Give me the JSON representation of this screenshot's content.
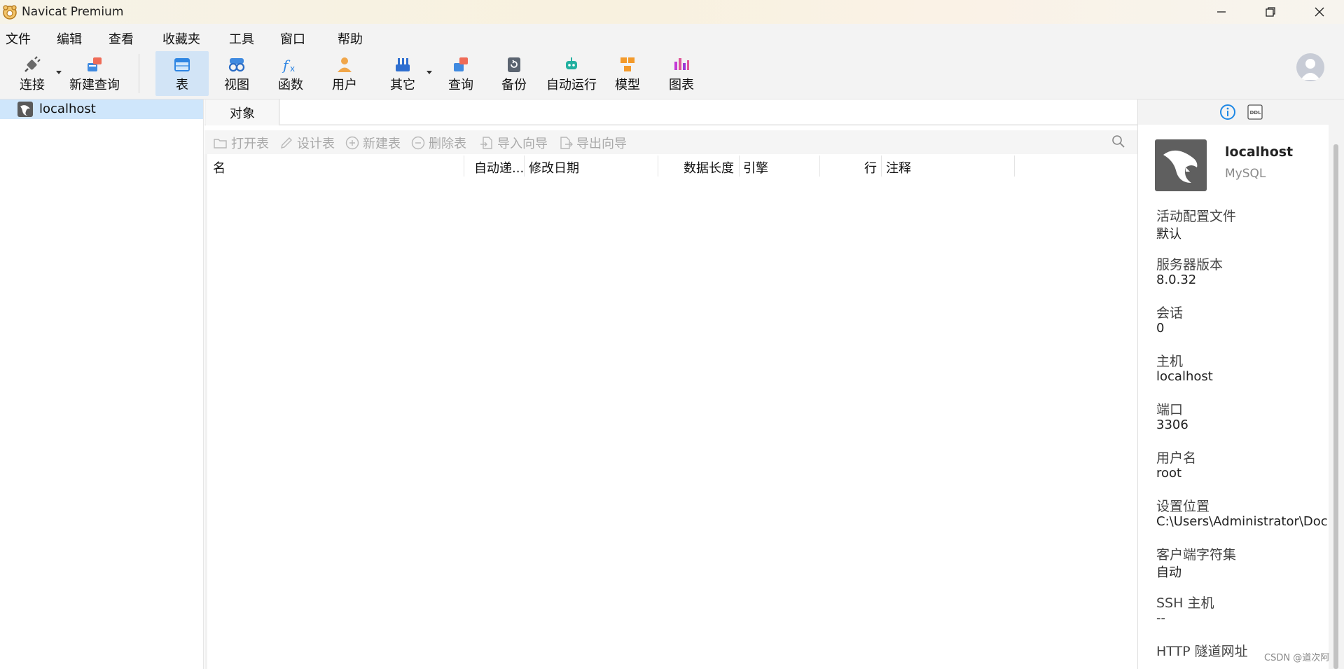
{
  "window": {
    "title": "Navicat Premium"
  },
  "menu": [
    "文件",
    "编辑",
    "查看",
    "收藏夹",
    "工具",
    "窗口",
    "帮助"
  ],
  "toolbar": {
    "connect": "连接",
    "new_query": "新建查询",
    "table": "表",
    "view": "视图",
    "function": "函数",
    "user": "用户",
    "others": "其它",
    "query": "查询",
    "backup": "备份",
    "automation": "自动运行",
    "model": "模型",
    "chart": "图表",
    "active": "表"
  },
  "navigator": {
    "items": [
      {
        "label": "localhost",
        "icon": "mysql-connection-icon",
        "selected": true
      }
    ]
  },
  "tabs": {
    "objects": "对象"
  },
  "object_toolbar": {
    "open_table": "打开表",
    "design_table": "设计表",
    "new_table": "新建表",
    "delete_table": "删除表",
    "import_wizard": "导入向导",
    "export_wizard": "导出向导"
  },
  "grid": {
    "columns": [
      "名",
      "自动递...",
      "修改日期",
      "数据长度",
      "引擎",
      "行",
      "注释"
    ]
  },
  "info": {
    "connection_name": "localhost",
    "connection_type": "MySQL",
    "properties": [
      {
        "label": "活动配置文件",
        "value": "默认"
      },
      {
        "label": "服务器版本",
        "value": "8.0.32"
      },
      {
        "label": "会话",
        "value": "0"
      },
      {
        "label": "主机",
        "value": "localhost"
      },
      {
        "label": "端口",
        "value": "3306"
      },
      {
        "label": "用户名",
        "value": "root"
      },
      {
        "label": "设置位置",
        "value": "C:\\Users\\Administrator\\Docu"
      },
      {
        "label": "客户端字符集",
        "value": "自动"
      },
      {
        "label": "SSH 主机",
        "value": "--"
      },
      {
        "label": "HTTP 隧道网址",
        "value": ""
      }
    ]
  },
  "watermark": "CSDN @道次阿",
  "colors": {
    "accent": "#1e88e5",
    "selected_bg": "#cfe6fb",
    "active_tool_bg": "#d2e4f6",
    "disabled_text": "#a9a9a9"
  }
}
